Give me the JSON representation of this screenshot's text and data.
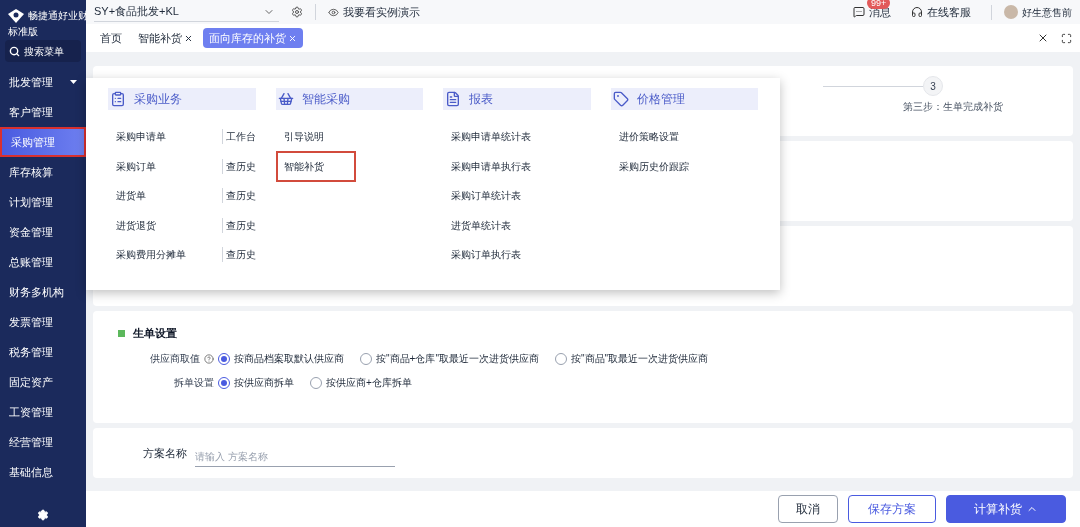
{
  "app": {
    "name": "畅捷通好业财",
    "edition": "标准版"
  },
  "search_menu": {
    "label": "搜索菜单"
  },
  "sidebar": {
    "items": [
      {
        "label": "批发管理",
        "selected": false,
        "expandable": true,
        "highlighted": false
      },
      {
        "label": "客户管理",
        "selected": false,
        "expandable": false,
        "highlighted": false
      },
      {
        "label": "采购管理",
        "selected": true,
        "expandable": false,
        "highlighted": true
      },
      {
        "label": "库存核算",
        "selected": false,
        "expandable": false,
        "highlighted": false
      },
      {
        "label": "计划管理",
        "selected": false,
        "expandable": false,
        "highlighted": false
      },
      {
        "label": "资金管理",
        "selected": false,
        "expandable": false,
        "highlighted": false
      },
      {
        "label": "总账管理",
        "selected": false,
        "expandable": false,
        "highlighted": false
      },
      {
        "label": "财务多机构",
        "selected": false,
        "expandable": false,
        "highlighted": false
      },
      {
        "label": "发票管理",
        "selected": false,
        "expandable": false,
        "highlighted": false
      },
      {
        "label": "税务管理",
        "selected": false,
        "expandable": false,
        "highlighted": false
      },
      {
        "label": "固定资产",
        "selected": false,
        "expandable": false,
        "highlighted": false
      },
      {
        "label": "工资管理",
        "selected": false,
        "expandable": false,
        "highlighted": false
      },
      {
        "label": "经营管理",
        "selected": false,
        "expandable": false,
        "highlighted": false
      },
      {
        "label": "基础信息",
        "selected": false,
        "expandable": false,
        "highlighted": false
      }
    ]
  },
  "topbar": {
    "account": "SY+食品批发+KL",
    "demo_link": "我要看实例演示",
    "messages": {
      "label": "消息",
      "badge": "99+"
    },
    "support": "在线客服",
    "user": "好生意售前"
  },
  "tabs": [
    {
      "label": "首页",
      "selected": false,
      "closable": false
    },
    {
      "label": "智能补货",
      "selected": false,
      "closable": true
    },
    {
      "label": "面向库存的补货",
      "selected": true,
      "closable": true
    }
  ],
  "steps": [
    {
      "number": "3",
      "label": "第三步：生单完成补货"
    }
  ],
  "order_settings": {
    "title": "生单设置",
    "rows": [
      {
        "label": "供应商取值",
        "help": true,
        "options": [
          {
            "label": "按商品档案取默认供应商",
            "selected": true
          },
          {
            "label": "按\"商品+仓库\"取最近一次进货供应商",
            "selected": false
          },
          {
            "label": "按\"商品\"取最近一次进货供应商",
            "selected": false
          }
        ]
      },
      {
        "label": "拆单设置",
        "help": false,
        "options": [
          {
            "label": "按供应商拆单",
            "selected": true
          },
          {
            "label": "按供应商+仓库拆单",
            "selected": false
          }
        ]
      }
    ]
  },
  "plan_name": {
    "label": "方案名称",
    "placeholder": "请输入 方案名称"
  },
  "buttons": [
    {
      "label": "取消",
      "kind": "default",
      "caret": false
    },
    {
      "label": "保存方案",
      "kind": "outline",
      "caret": false
    },
    {
      "label": "计算补货",
      "kind": "primary",
      "caret": true
    }
  ],
  "mega_menu": {
    "columns": [
      {
        "title": "采购业务",
        "items": [
          {
            "label": "采购申请单",
            "side_link": "工作台",
            "highlighted": false
          },
          {
            "label": "采购订单",
            "side_link": "查历史",
            "highlighted": false
          },
          {
            "label": "进货单",
            "side_link": "查历史",
            "highlighted": false
          },
          {
            "label": "进货退货",
            "side_link": "查历史",
            "highlighted": false
          },
          {
            "label": "采购费用分摊单",
            "side_link": "查历史",
            "highlighted": false
          }
        ]
      },
      {
        "title": "智能采购",
        "items": [
          {
            "label": "引导说明",
            "highlighted": false
          },
          {
            "label": "智能补货",
            "highlighted": true
          }
        ]
      },
      {
        "title": "报表",
        "items": [
          {
            "label": "采购申请单统计表",
            "highlighted": false
          },
          {
            "label": "采购申请单执行表",
            "highlighted": false
          },
          {
            "label": "采购订单统计表",
            "highlighted": false
          },
          {
            "label": "进货单统计表",
            "highlighted": false
          },
          {
            "label": "采购订单执行表",
            "highlighted": false
          }
        ]
      },
      {
        "title": "价格管理",
        "items": [
          {
            "label": "进价策略设置",
            "highlighted": false
          },
          {
            "label": "采购历史价跟踪",
            "highlighted": false
          }
        ]
      }
    ]
  }
}
